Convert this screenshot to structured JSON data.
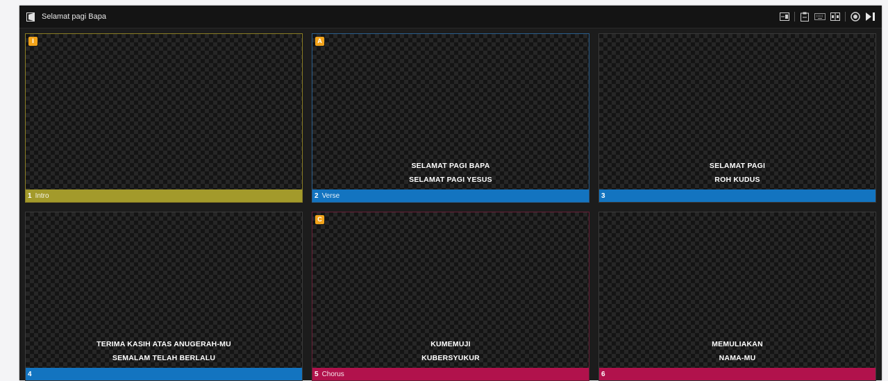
{
  "window": {
    "title": "Selamat pagi Bapa",
    "title_icon": "presentation-icon"
  },
  "toolbar": {
    "icons": [
      "output-icon",
      "clipboard-icon",
      "keyboard-icon",
      "layout-split-icon",
      "record-icon",
      "next-icon"
    ]
  },
  "colors": {
    "intro": "#a39a2b",
    "verse": "#1374c0",
    "chorus": "#b1124c",
    "badge": "#f2a31a"
  },
  "slides": [
    {
      "number": "1",
      "group": "Intro",
      "badge": "I",
      "line1": "",
      "line2": "",
      "color": "#a39a2b"
    },
    {
      "number": "2",
      "group": "Verse",
      "badge": "A",
      "line1": "SELAMAT PAGI BAPA",
      "line2": "SELAMAT PAGI YESUS",
      "color": "#1374c0"
    },
    {
      "number": "3",
      "group": "",
      "badge": "",
      "line1": "SELAMAT PAGI",
      "line2": "ROH KUDUS",
      "color": "#1374c0"
    },
    {
      "number": "4",
      "group": "",
      "badge": "",
      "line1": "TERIMA KASIH ATAS ANUGERAH-MU",
      "line2": "SEMALAM TELAH BERLALU",
      "color": "#1374c0"
    },
    {
      "number": "5",
      "group": "Chorus",
      "badge": "C",
      "line1": "KUMEMUJI",
      "line2": "KUBERSYUKUR",
      "color": "#b1124c"
    },
    {
      "number": "6",
      "group": "",
      "badge": "",
      "line1": "MEMULIAKAN",
      "line2": "NAMA-MU",
      "color": "#b1124c"
    }
  ]
}
